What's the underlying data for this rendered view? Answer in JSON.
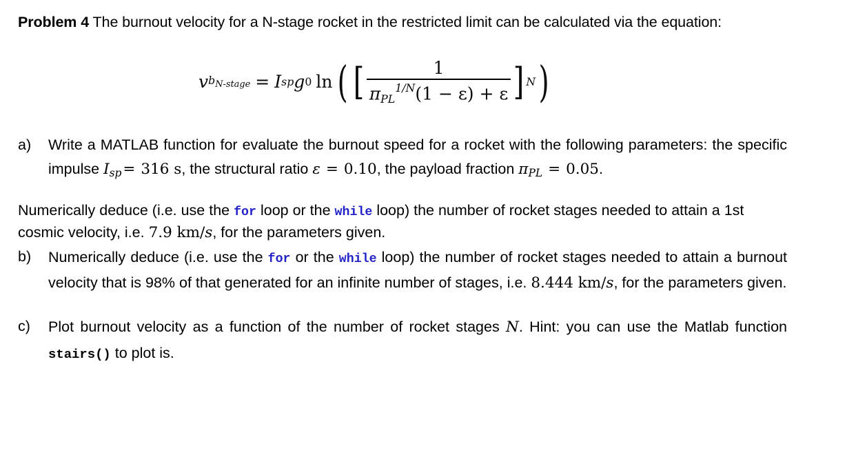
{
  "document": {
    "problem_label": "Problem 4",
    "intro_text": " The burnout velocity for a N-stage rocket in the restricted limit can be calculated via the equation:",
    "equation": {
      "lhs_var": "v",
      "lhs_sub": "b",
      "lhs_sub2": "N-stage",
      "equals": "=",
      "isp": "I",
      "isp_sub": "sp",
      "g": "g",
      "g_sub": "0",
      "ln": "ln",
      "open_paren": "(",
      "open_bracket": "[",
      "numerator": "1",
      "denominator_pi": "π",
      "denominator_pi_sub": "PL",
      "denominator_exp": "1/N",
      "denominator_rest": "(1 − ε) + ε",
      "close_bracket": "]",
      "exponent": "N",
      "close_paren": ")"
    },
    "items": [
      {
        "marker": "a)",
        "text_1": "Write a MATLAB function for evaluate the burnout speed for a rocket with the following parameters: the specific impulse  ",
        "isp_symbol": "I",
        "isp_sub": "sp",
        "eq1": "=",
        "isp_value": "316 s",
        "text_2": ", the structural ratio ",
        "eps_symbol": "ε",
        "eq2": "=",
        "eps_value": "0.10",
        "text_3": ", the payload fraction ",
        "pi_symbol": "π",
        "pi_sub": "PL",
        "eq3": "=",
        "pi_value": "0.05",
        "text_4": "."
      }
    ],
    "paragraph": {
      "part_1": "Numerically deduce (i.e. use the ",
      "kw_for": "for",
      "part_2": " loop or the ",
      "kw_while": "while",
      "part_3": " loop) the number of rocket stages needed to attain a 1st cosmic velocity, i.e. ",
      "velocity": "7.9 km/",
      "velocity_unit": "s",
      "part_4": ", for the parameters given."
    },
    "item_b": {
      "marker": "b)",
      "part_1": "Numerically deduce (i.e. use the ",
      "kw_for": "for",
      "part_2": " or the ",
      "kw_while": "while",
      "part_3": " loop) the number of rocket stages needed to attain a burnout velocity that is 98% of that generated for an infinite number of stages, i.e. ",
      "velocity": "8.444 km/",
      "velocity_unit": "s",
      "part_4": ", for the parameters given."
    },
    "item_c": {
      "marker": "c)",
      "part_1": "Plot burnout velocity as a function of the number of rocket stages ",
      "n_symbol": "N",
      "part_2": ". Hint: you can use the Matlab function ",
      "code": "stairs()",
      "part_3": " to plot is."
    },
    "colors": {
      "keyword_blue": "#2222c8",
      "text_black": "#000000",
      "background": "#ffffff"
    }
  }
}
